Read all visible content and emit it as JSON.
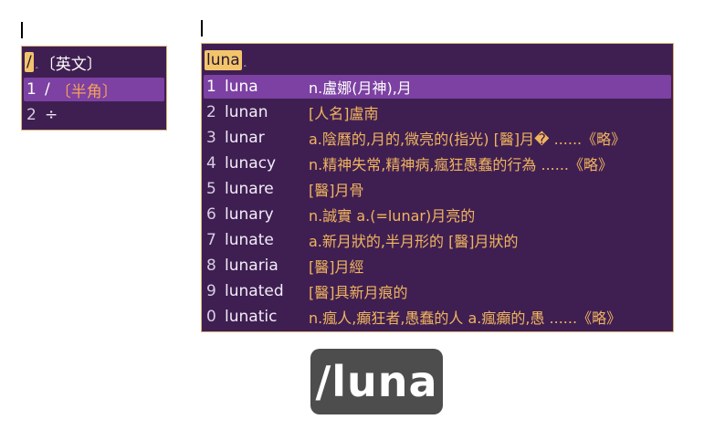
{
  "left_panel": {
    "preedit": "/",
    "mode_label": "〔英文〕",
    "candidates": [
      {
        "index": "1",
        "text": "/",
        "annotation": "〔半角〕"
      },
      {
        "index": "2",
        "text": "÷",
        "annotation": ""
      }
    ]
  },
  "right_panel": {
    "preedit": "luna",
    "candidates": [
      {
        "index": "1",
        "word": "luna",
        "definition": "n.盧娜(月神),月"
      },
      {
        "index": "2",
        "word": "lunan",
        "definition": "[人名]盧南"
      },
      {
        "index": "3",
        "word": "lunar",
        "definition": "a.陰曆的,月的,微亮的(指光) [醫]月� ......《略》"
      },
      {
        "index": "4",
        "word": "lunacy",
        "definition": "n.精神失常,精神病,瘋狂愚蠢的行為  ......《略》"
      },
      {
        "index": "5",
        "word": "lunare",
        "definition": "[醫]月骨"
      },
      {
        "index": "6",
        "word": "lunary",
        "definition": "n.誠實 a.(=lunar)月亮的"
      },
      {
        "index": "7",
        "word": "lunate",
        "definition": "a.新月狀的,半月形的 [醫]月狀的"
      },
      {
        "index": "8",
        "word": "lunaria",
        "definition": "[醫]月經"
      },
      {
        "index": "9",
        "word": "lunated",
        "definition": "[醫]具新月痕的"
      },
      {
        "index": "0",
        "word": "lunatic",
        "definition": "n.瘋人,癲狂者,愚蠢的人 a.瘋癲的,愚 ......《略》"
      }
    ]
  },
  "key_badge": {
    "text": "/luna"
  },
  "colors": {
    "panel_bg": "#3f1f52",
    "selected_bg": "#7c41a2",
    "highlight": "#f3c56b",
    "definition": "#f0b45e"
  }
}
